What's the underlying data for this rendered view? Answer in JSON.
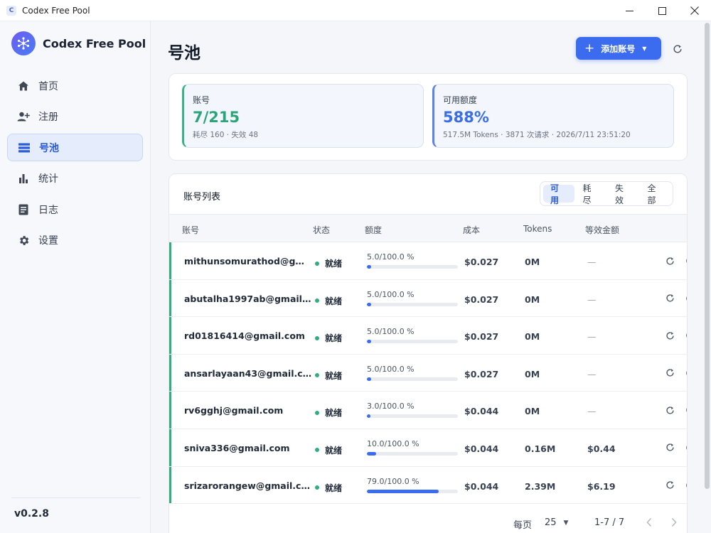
{
  "window": {
    "title": "Codex Free Pool",
    "app_icon_letter": "C",
    "minimize": "—",
    "maximize": "☐",
    "close": "✕"
  },
  "sidebar": {
    "brand": "Codex Free Pool",
    "items": [
      {
        "label": "首页",
        "icon": "home-icon"
      },
      {
        "label": "注册",
        "icon": "person-add-icon"
      },
      {
        "label": "号池",
        "icon": "list-icon",
        "active": true
      },
      {
        "label": "统计",
        "icon": "bar-chart-icon"
      },
      {
        "label": "日志",
        "icon": "document-icon"
      },
      {
        "label": "设置",
        "icon": "gear-icon"
      }
    ],
    "version": "v0.2.8"
  },
  "header": {
    "title": "号池",
    "add_button": "添加账号"
  },
  "stats": {
    "accounts": {
      "label": "账号",
      "value": "7/215",
      "sub": "耗尽 160 · 失效 48",
      "accent": "#2aa579"
    },
    "quota": {
      "label": "可用额度",
      "value": "588%",
      "sub": "517.5M Tokens · 3871 次请求 · 2026/7/11 23:51:20",
      "accent": "#3a6de8"
    }
  },
  "table": {
    "title": "账号列表",
    "filters": [
      "可用",
      "耗尽",
      "失效",
      "全部"
    ],
    "active_filter": "可用",
    "columns": [
      "账号",
      "状态",
      "额度",
      "成本",
      "Tokens",
      "等效金额"
    ],
    "rows": [
      {
        "account": "mithunsomurathod@gm...",
        "status": "就绪",
        "quota": "5.0/100.0 %",
        "quota_fraction": 0.05,
        "cost": "$0.027",
        "tokens": "0M",
        "equiv": "—"
      },
      {
        "account": "abutalha1997ab@gmail....",
        "status": "就绪",
        "quota": "5.0/100.0 %",
        "quota_fraction": 0.05,
        "cost": "$0.027",
        "tokens": "0M",
        "equiv": "—"
      },
      {
        "account": "rd01816414@gmail.com",
        "status": "就绪",
        "quota": "5.0/100.0 %",
        "quota_fraction": 0.05,
        "cost": "$0.027",
        "tokens": "0M",
        "equiv": "—"
      },
      {
        "account": "ansarlayaan43@gmail.c...",
        "status": "就绪",
        "quota": "5.0/100.0 %",
        "quota_fraction": 0.05,
        "cost": "$0.027",
        "tokens": "0M",
        "equiv": "—"
      },
      {
        "account": "rv6gghj@gmail.com",
        "status": "就绪",
        "quota": "3.0/100.0 %",
        "quota_fraction": 0.03,
        "cost": "$0.044",
        "tokens": "0M",
        "equiv": "—"
      },
      {
        "account": "sniva336@gmail.com",
        "status": "就绪",
        "quota": "10.0/100.0 %",
        "quota_fraction": 0.1,
        "cost": "$0.044",
        "tokens": "0.16M",
        "equiv": "$0.44"
      },
      {
        "account": "srizarorangew@gmail.com",
        "status": "就绪",
        "quota": "79.0/100.0 %",
        "quota_fraction": 0.79,
        "cost": "$0.044",
        "tokens": "2.39M",
        "equiv": "$6.19"
      }
    ]
  },
  "pagination": {
    "per_page_label": "每页",
    "per_page": "25",
    "range": "1-7 / 7"
  }
}
